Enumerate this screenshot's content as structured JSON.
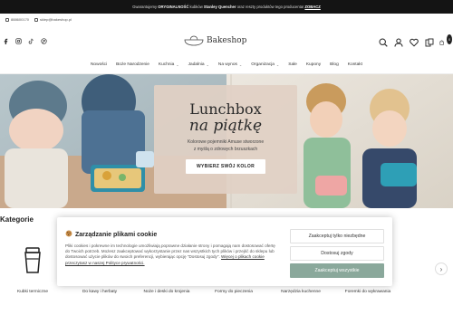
{
  "topbar": {
    "part1": "Gwarantujemy",
    "bold1": "ORYGINALNOŚĆ",
    "part2": "kubków",
    "bold2": "Stanley Quencher",
    "part3": "oraz reszty produktów tego producenta!",
    "link": "ZOBACZ"
  },
  "header": {
    "phone": "888600170",
    "email": "sklep@bakeshop.pl",
    "logo_text": "Bakeshop",
    "cart_count": "0"
  },
  "nav": {
    "items": [
      {
        "label": "Nowości",
        "dropdown": false
      },
      {
        "label": "Boże Narodzenie",
        "dropdown": false
      },
      {
        "label": "Kuchnia",
        "dropdown": true
      },
      {
        "label": "Jadalnia",
        "dropdown": true
      },
      {
        "label": "Na wynos",
        "dropdown": true
      },
      {
        "label": "Organizacja",
        "dropdown": true
      },
      {
        "label": "Sale",
        "dropdown": false
      },
      {
        "label": "Kupony",
        "dropdown": false
      },
      {
        "label": "Blog",
        "dropdown": false
      },
      {
        "label": "Kontakt",
        "dropdown": false
      }
    ]
  },
  "hero": {
    "title1": "Lunchbox",
    "title2": "na piątkę",
    "sub1": "Kolorowe pojemniki Amuse stworzone",
    "sub2": "z myślą o zdrowych brzuszkach",
    "button": "WYBIERZ SWÓJ KOLOR"
  },
  "categories": {
    "title": "Kategorie",
    "items": [
      {
        "label": "Kubki termiczne"
      },
      {
        "label": "Do kawy i herbaty"
      },
      {
        "label": "Noże i deski do krojenia"
      },
      {
        "label": "Formy do pieczenia"
      },
      {
        "label": "Narzędzia kuchenne"
      },
      {
        "label": "Foremki do wykrawania"
      }
    ]
  },
  "cookie": {
    "title": "Zarządzanie plikami cookie",
    "text": "Pliki cookies i pokrewne im technologie umożliwiają poprawne działanie strony i pomagają nam dostosować ofertę do Twoich potrzeb. Możesz zaakceptować wykorzystanie przez nas wszystkich tych plików i przejść do sklepu lub dostosować użycie plików do swoich preferencji, wybierając opcję \"Dostosuj zgody\".",
    "link": "Więcej o plikach cookie przeczytasz w naszej Polityce prywatności.",
    "btn_necessary": "Zaakceptuj tylko niezbędne",
    "btn_customize": "Dostosuj zgody",
    "btn_accept_all": "Zaakceptuj wszystkie"
  },
  "colors": {
    "topbar_bg": "#141414",
    "accent_green": "#8aa89b",
    "hero_card": "#e1d0c4"
  }
}
